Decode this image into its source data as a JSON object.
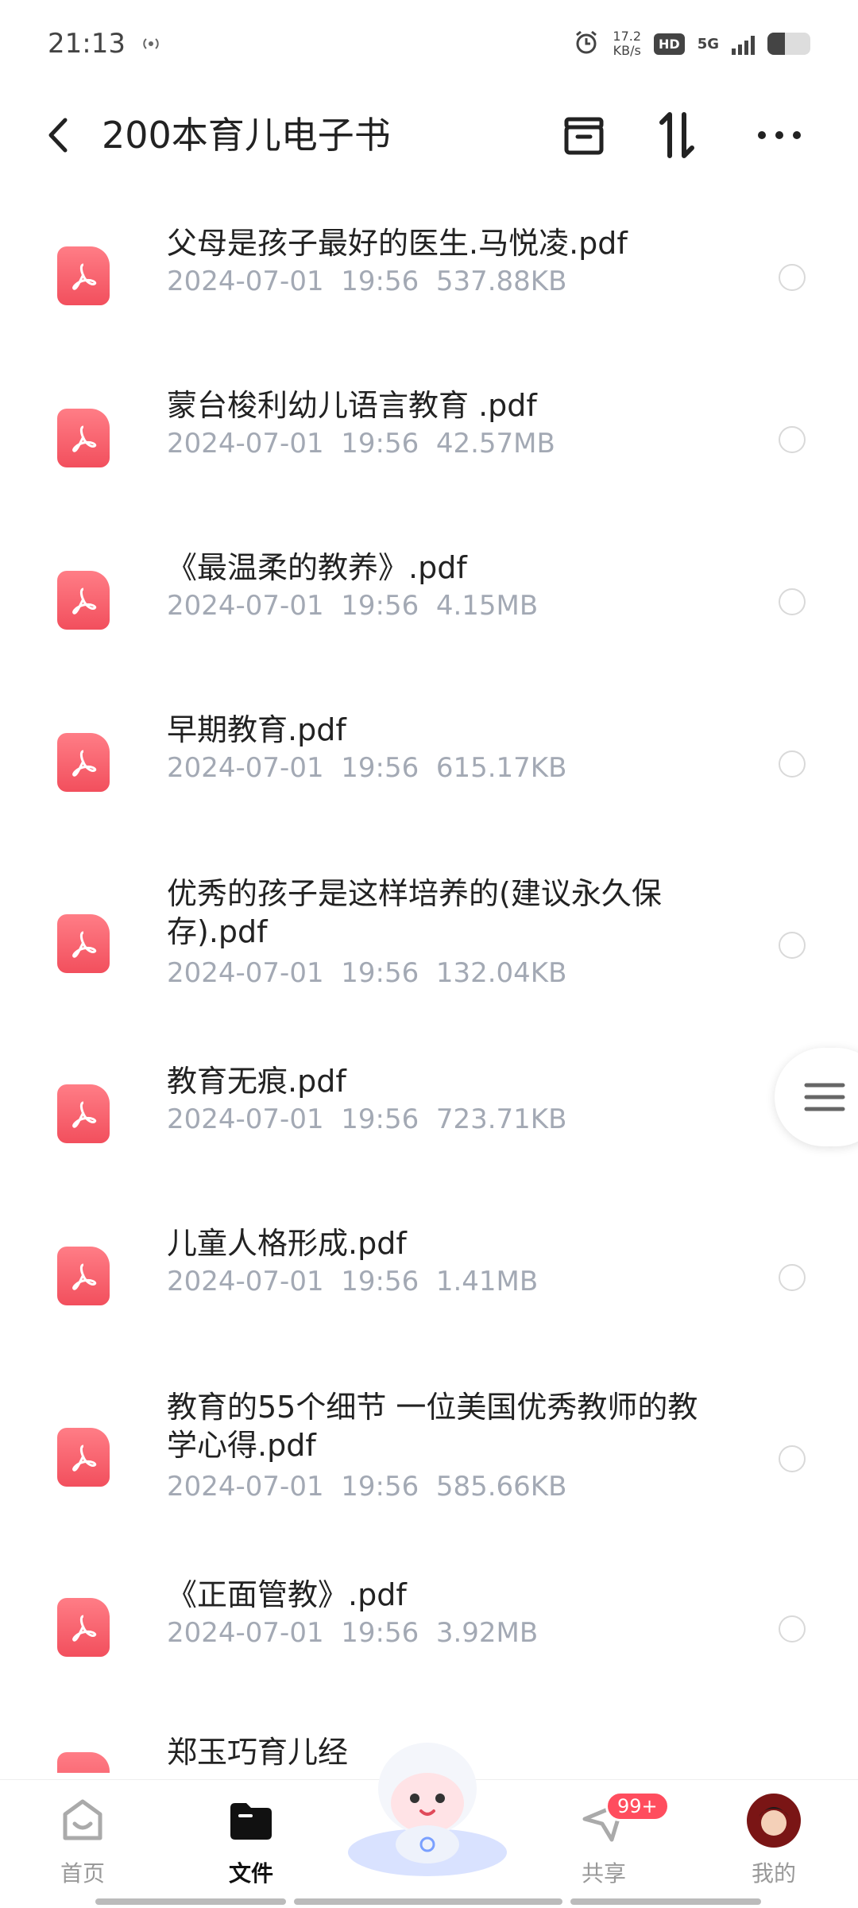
{
  "status": {
    "time": "21:13",
    "net_icon": "hotspot-icon",
    "speed_value": "17.2",
    "speed_unit": "KB/s",
    "hd": "HD",
    "network": "5G"
  },
  "header": {
    "title": "200本育儿电子书",
    "back_icon": "back-arrow-icon",
    "icons": [
      "archive-icon",
      "sort-icon",
      "more-icon"
    ]
  },
  "files": [
    {
      "name": "父母是孩子最好的医生.马悦凌.pdf",
      "date": "2024-07-01",
      "time": "19:56",
      "size": "537.88KB"
    },
    {
      "name": "蒙台梭利幼儿语言教育 .pdf",
      "date": "2024-07-01",
      "time": "19:56",
      "size": "42.57MB"
    },
    {
      "name": "《最温柔的教养》.pdf",
      "date": "2024-07-01",
      "time": "19:56",
      "size": "4.15MB"
    },
    {
      "name": "早期教育.pdf",
      "date": "2024-07-01",
      "time": "19:56",
      "size": "615.17KB"
    },
    {
      "name": "优秀的孩子是这样培养的(建议永久保存).pdf",
      "date": "2024-07-01",
      "time": "19:56",
      "size": "132.04KB"
    },
    {
      "name": "教育无痕.pdf",
      "date": "2024-07-01",
      "time": "19:56",
      "size": "723.71KB"
    },
    {
      "name": "儿童人格形成.pdf",
      "date": "2024-07-01",
      "time": "19:56",
      "size": "1.41MB"
    },
    {
      "name": "教育的55个细节 一位美国优秀教师的教学心得.pdf",
      "date": "2024-07-01",
      "time": "19:56",
      "size": "585.66KB"
    },
    {
      "name": "《正面管教》.pdf",
      "date": "2024-07-01",
      "time": "19:56",
      "size": "3.92MB"
    },
    {
      "name": "郑玉巧育儿经",
      "date": "",
      "time": "",
      "size": ""
    }
  ],
  "nav": {
    "home": "首页",
    "files": "文件",
    "share": "共享",
    "share_badge": "99+",
    "mine": "我的"
  },
  "colors": {
    "pdf_red": "#f24f5d",
    "meta_gray": "#a3a9b4",
    "badge_red": "#ff4d5e"
  }
}
